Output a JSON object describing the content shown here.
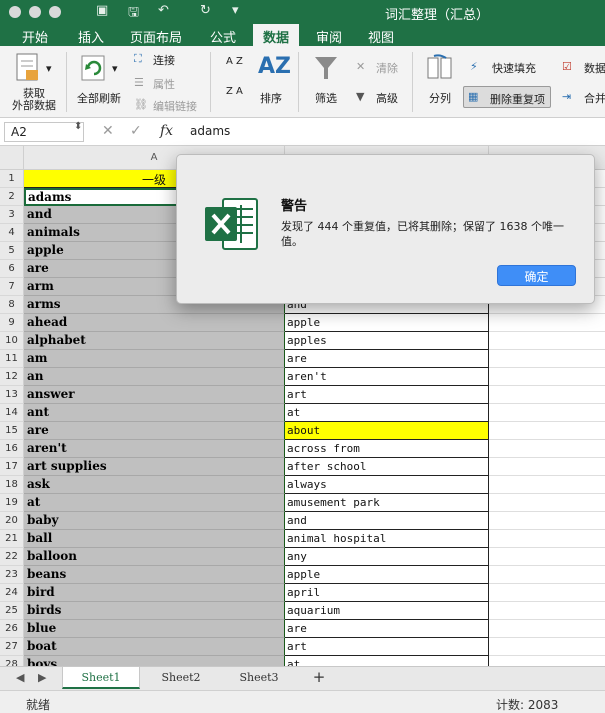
{
  "window": {
    "title": "词汇整理（汇总）"
  },
  "tabs": [
    "开始",
    "插入",
    "页面布局",
    "公式",
    "数据",
    "审阅",
    "视图"
  ],
  "ribbon": {
    "get_external": "获取\n外部数据",
    "refresh_all": "全部刷新",
    "connections": "连接",
    "properties": "属性",
    "edit_links": "编辑链接",
    "sort": "排序",
    "filter": "筛选",
    "clear": "清除",
    "advanced": "高级",
    "text_to_columns": "分列",
    "flash_fill": "快速填充",
    "remove_duplicates": "删除重复项",
    "data_validation": "数据",
    "consolidate": "合并",
    "sort_az": "A Z",
    "sort_za": "Z A",
    "az_big": "AZ"
  },
  "formula_bar": {
    "name_box": "A2",
    "value": "adams",
    "fx": "fx",
    "cancel": "✕",
    "confirm": "✓"
  },
  "columns": {
    "a": "A"
  },
  "header_row": {
    "num": "1",
    "a": "一级",
    "b": ""
  },
  "rows": [
    {
      "num": "2",
      "a": "adams",
      "b": ""
    },
    {
      "num": "3",
      "a": "and",
      "b": ""
    },
    {
      "num": "4",
      "a": "animals",
      "b": ""
    },
    {
      "num": "5",
      "a": "apple",
      "b": ""
    },
    {
      "num": "6",
      "a": "are",
      "b": ""
    },
    {
      "num": "7",
      "a": "arm",
      "b": ""
    },
    {
      "num": "8",
      "a": "arms",
      "b": "and"
    },
    {
      "num": "9",
      "a": "ahead",
      "b": "apple"
    },
    {
      "num": "10",
      "a": "alphabet",
      "b": "apples"
    },
    {
      "num": "11",
      "a": "am",
      "b": "are"
    },
    {
      "num": "12",
      "a": "an",
      "b": "aren't"
    },
    {
      "num": "13",
      "a": "answer",
      "b": "art"
    },
    {
      "num": "14",
      "a": "ant",
      "b": "at"
    },
    {
      "num": "15",
      "a": "are",
      "b": "about"
    },
    {
      "num": "16",
      "a": "aren't",
      "b": "across from"
    },
    {
      "num": "17",
      "a": "art supplies",
      "b": "after school"
    },
    {
      "num": "18",
      "a": "ask",
      "b": "always"
    },
    {
      "num": "19",
      "a": "at",
      "b": "amusement park"
    },
    {
      "num": "20",
      "a": "baby",
      "b": "and"
    },
    {
      "num": "21",
      "a": "ball",
      "b": "animal hospital"
    },
    {
      "num": "22",
      "a": "balloon",
      "b": "any"
    },
    {
      "num": "23",
      "a": "beans",
      "b": "apple"
    },
    {
      "num": "24",
      "a": "bird",
      "b": "april"
    },
    {
      "num": "25",
      "a": "birds",
      "b": "aquarium"
    },
    {
      "num": "26",
      "a": "blue",
      "b": "are"
    },
    {
      "num": "27",
      "a": "boat",
      "b": "art"
    },
    {
      "num": "28",
      "a": "boys",
      "b": "at"
    }
  ],
  "sheets": [
    "Sheet1",
    "Sheet2",
    "Sheet3"
  ],
  "add_sheet": "+",
  "status": {
    "left": "就绪",
    "count": "计数: 2083"
  },
  "dialog": {
    "title": "警告",
    "message": "发现了 444 个重复值，已将其删除；保留了 1638 个唯一值。",
    "ok": "确定"
  },
  "colors": {
    "excel_green": "#1f7145",
    "highlight_yellow": "#ffff00",
    "button_blue": "#3f8ef7"
  }
}
